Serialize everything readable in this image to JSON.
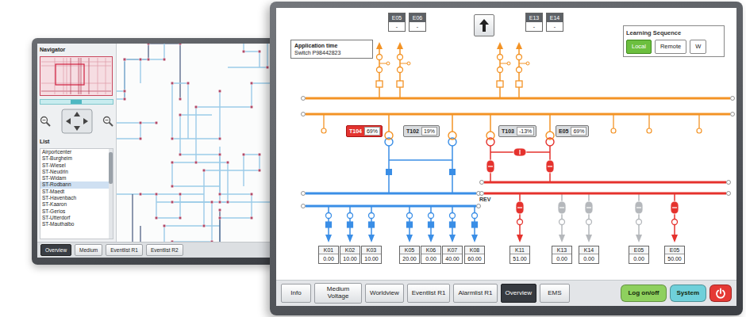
{
  "back_monitor": {
    "navigator": {
      "title": "Navigator"
    },
    "list": {
      "title": "List",
      "items": [
        {
          "label": "Airportcenter",
          "selected": false
        },
        {
          "label": "ST-Burgheim",
          "selected": false
        },
        {
          "label": "ST-Wiesel",
          "selected": false
        },
        {
          "label": "ST-Neudrin",
          "selected": false
        },
        {
          "label": "ST-Widam",
          "selected": false
        },
        {
          "label": "ST-Rodbann",
          "selected": true
        },
        {
          "label": "ST-Maedt",
          "selected": false
        },
        {
          "label": "ST-Havenbach",
          "selected": false
        },
        {
          "label": "ST-Kaaron",
          "selected": false
        },
        {
          "label": "ST-Gerios",
          "selected": false
        },
        {
          "label": "ST-Utterdorf",
          "selected": false
        },
        {
          "label": "ST-Mauthalbo",
          "selected": false
        }
      ]
    },
    "tabs": [
      {
        "label": "Overview",
        "selected": true
      },
      {
        "label": "Medium",
        "selected": false
      },
      {
        "label": "Eventlist R1",
        "selected": false
      },
      {
        "label": "Eventlist R2",
        "selected": false
      }
    ]
  },
  "front_monitor": {
    "application_time": {
      "title": "Application time",
      "value": "Switch P98442823"
    },
    "top_switches": [
      {
        "label": "E05",
        "value": "-"
      },
      {
        "label": "E06",
        "value": "-"
      },
      {
        "label": "E13",
        "value": "-"
      },
      {
        "label": "E14",
        "value": "-"
      }
    ],
    "learning_sequence": {
      "title": "Learning Sequence",
      "buttons": [
        {
          "label": "Local",
          "selected": true
        },
        {
          "label": "Remote",
          "selected": false
        },
        {
          "label": "W",
          "selected": false
        }
      ]
    },
    "buses": [
      {
        "color": "#f39325"
      },
      {
        "color": "#3a8ee6"
      },
      {
        "color": "#e5322d"
      }
    ],
    "bus_label": "REV",
    "transformers": [
      {
        "label": "T104",
        "reading": "69%",
        "alarm": true
      },
      {
        "label": "T102",
        "reading": "19%",
        "alarm": false
      },
      {
        "label": "T103",
        "reading": "-13%",
        "alarm": false
      },
      {
        "label": "E05",
        "reading": "69%",
        "alarm": false
      }
    ],
    "feeders": [
      {
        "label": "K01",
        "value": "0.00",
        "bus": 1,
        "energized": true
      },
      {
        "label": "K02",
        "value": "10.00",
        "bus": 1,
        "energized": true
      },
      {
        "label": "K03",
        "value": "10.00",
        "bus": 1,
        "energized": true
      },
      {
        "label": "K05",
        "value": "20.00",
        "bus": 1,
        "energized": true
      },
      {
        "label": "K06",
        "value": "0.00",
        "bus": 1,
        "energized": true
      },
      {
        "label": "K07",
        "value": "40.00",
        "bus": 1,
        "energized": true
      },
      {
        "label": "K08",
        "value": "60.00",
        "bus": 1,
        "energized": true
      },
      {
        "label": "K11",
        "value": "51.00",
        "bus": 2,
        "energized": true
      },
      {
        "label": "K13",
        "value": "0.00",
        "bus": 2,
        "energized": false
      },
      {
        "label": "K14",
        "value": "0.00",
        "bus": 2,
        "energized": false
      },
      {
        "label": "E05",
        "value": "0.00",
        "bus": 2,
        "energized": false
      },
      {
        "label": "E05",
        "value": "50.00",
        "bus": 2,
        "energized": true
      }
    ],
    "tabs": [
      {
        "label": "Info",
        "selected": false
      },
      {
        "label": "Medium Voltage",
        "selected": false
      },
      {
        "label": "Worldview",
        "selected": false
      },
      {
        "label": "Eventlist R1",
        "selected": false
      },
      {
        "label": "Alarmlist R1",
        "selected": false
      },
      {
        "label": "Overview",
        "selected": true
      },
      {
        "label": "EMS",
        "selected": false
      }
    ],
    "buttons": [
      {
        "label": "Log on/off",
        "color": "#8ed05e"
      },
      {
        "label": "System",
        "color": "#6fd0da"
      }
    ],
    "power_button": {
      "color": "#e53935"
    }
  }
}
